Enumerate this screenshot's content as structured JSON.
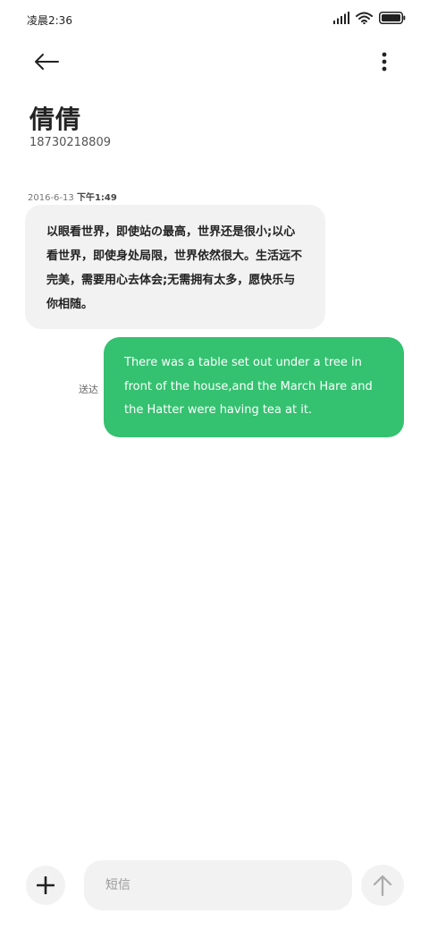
{
  "status_bar": {
    "time": "凌晨2:36",
    "icons": [
      "signal-icon",
      "wifi-icon",
      "battery-icon"
    ]
  },
  "top_bar": {
    "back_icon": "arrow-left-icon",
    "more_icon": "more-vertical-icon"
  },
  "contact": {
    "name": "倩倩",
    "number": "18730218809"
  },
  "messages": [
    {
      "direction": "incoming",
      "timestamp_date": "2016-6-13",
      "timestamp_time": "下午1:49",
      "text": "以眼看世界，即使站の最高，世界还是很小;以心看世界，即使身处局限，世界依然很大。生活远不完美，需要用心去体会;无需拥有太多，愿快乐与你相随。"
    },
    {
      "direction": "outgoing",
      "status": "送达",
      "text": "There was a table set out under a tree in front of the house,and the March Hare and the Hatter were having tea at it."
    }
  ],
  "composer": {
    "add_icon": "plus-icon",
    "placeholder": "短信",
    "send_icon": "arrow-up-icon"
  },
  "colors": {
    "outgoing_bubble": "#34c170",
    "incoming_bubble": "#f2f2f2",
    "background": "#ffffff"
  }
}
